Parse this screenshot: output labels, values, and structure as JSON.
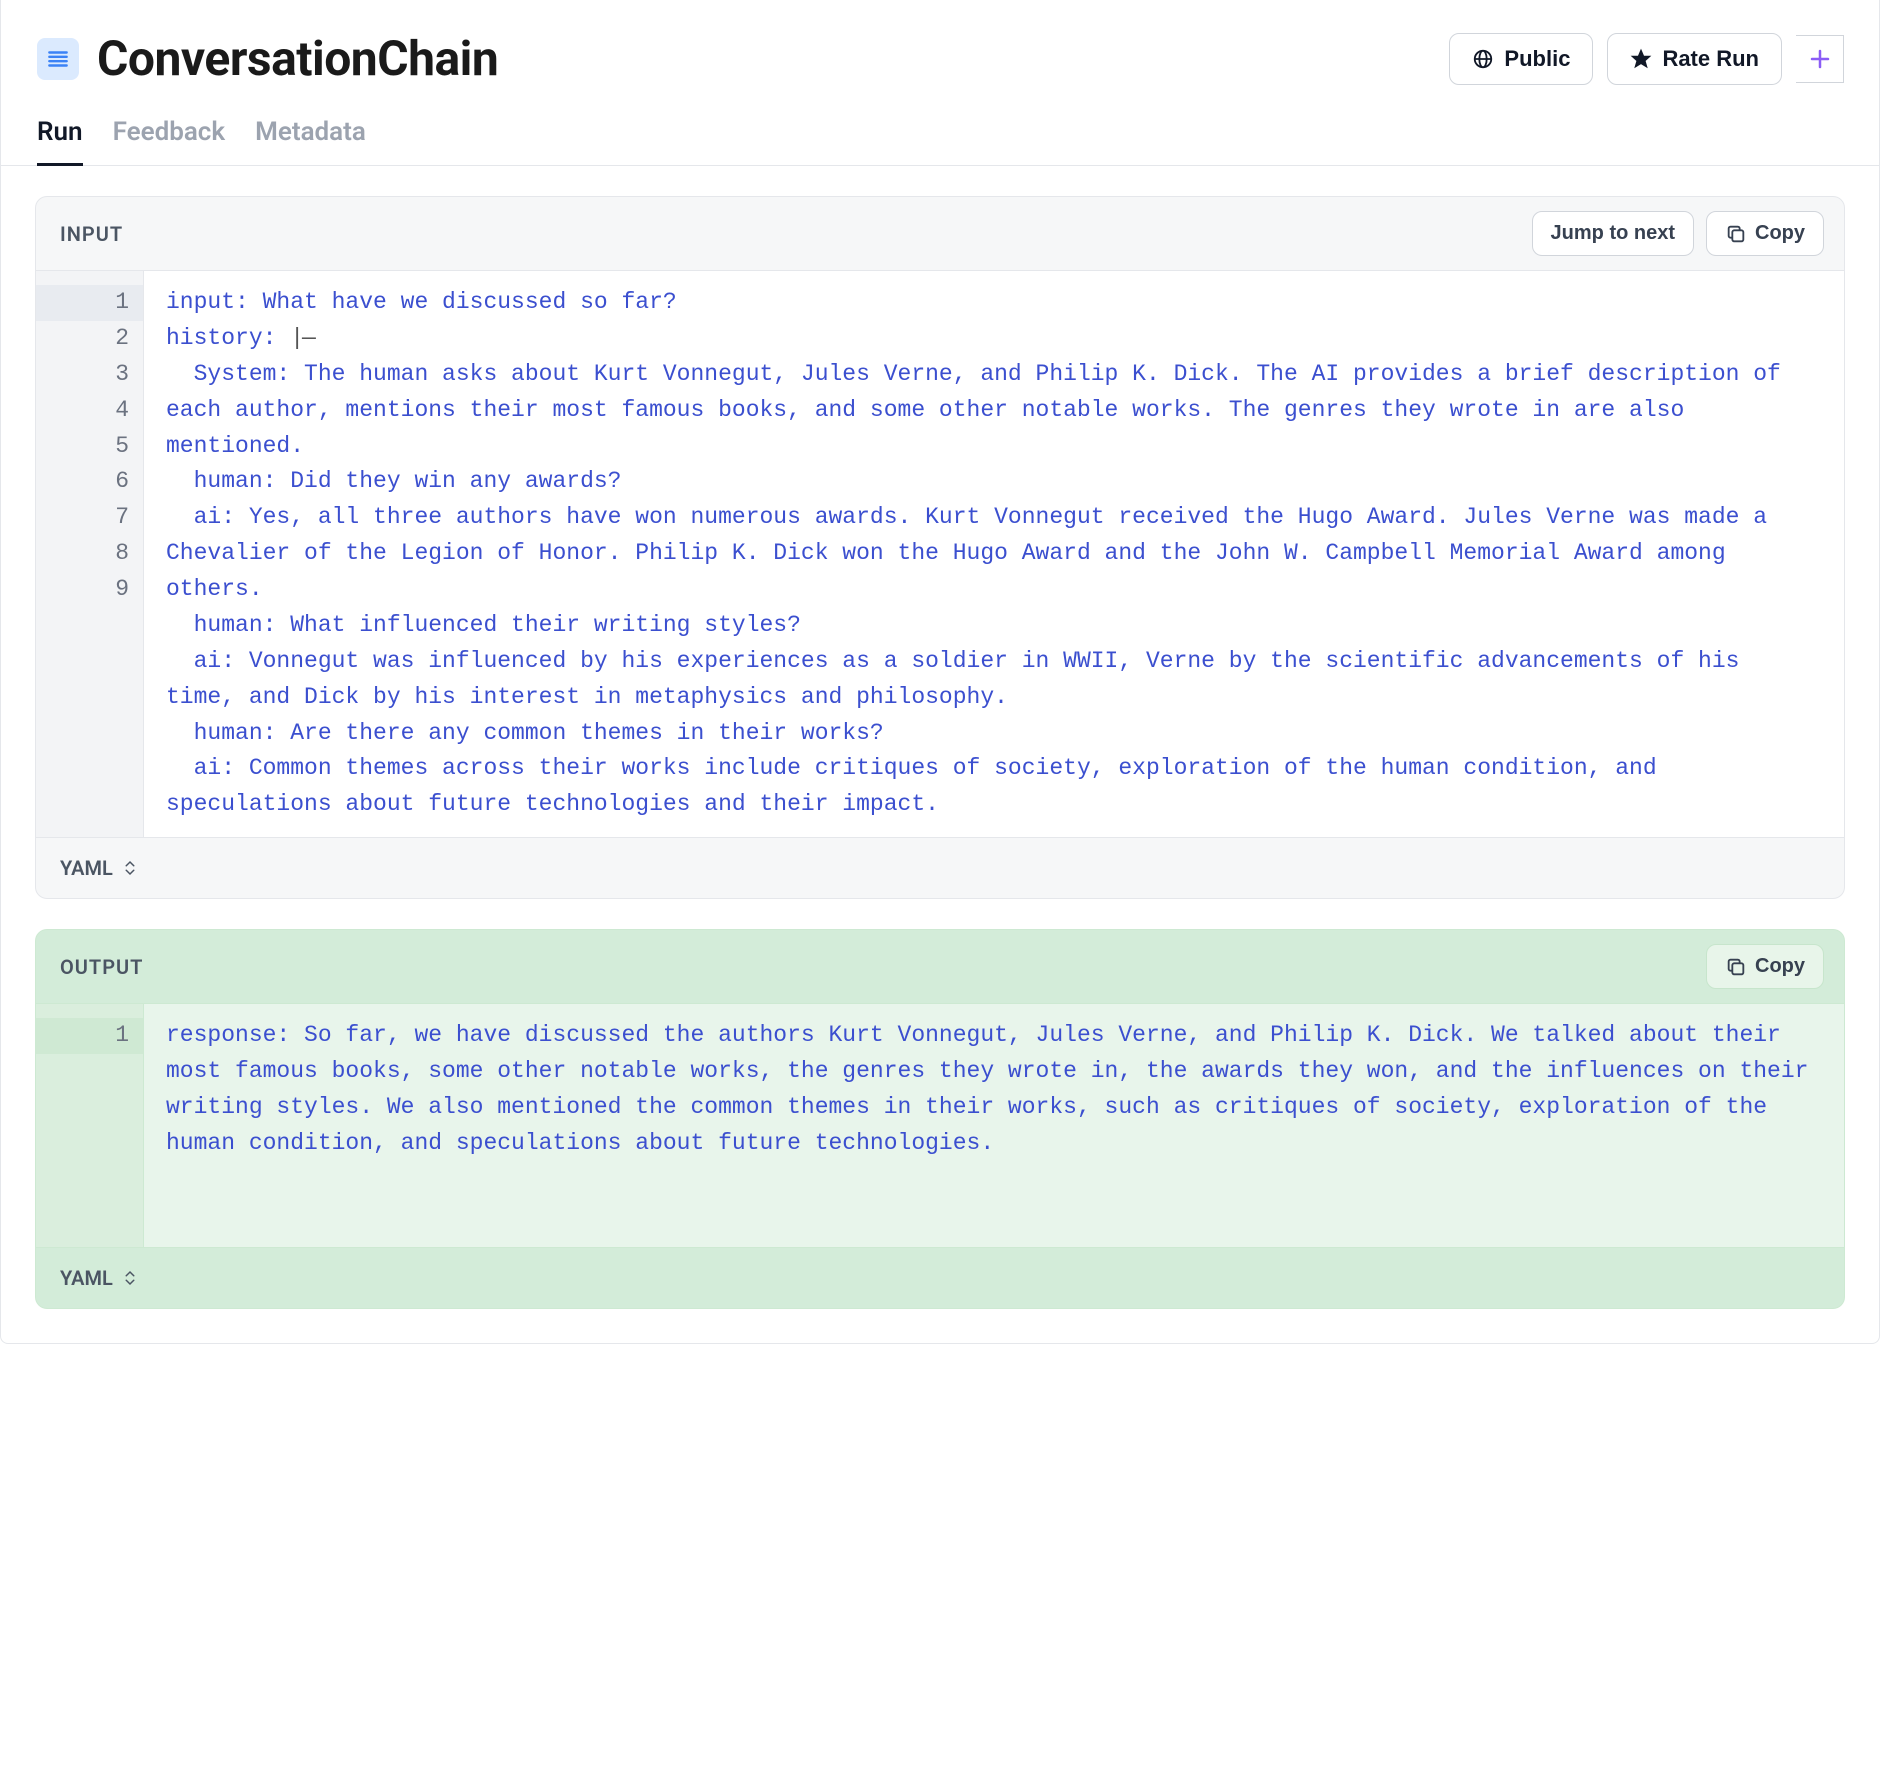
{
  "header": {
    "title": "ConversationChain",
    "public_label": "Public",
    "rate_label": "Rate Run"
  },
  "tabs": {
    "run": "Run",
    "feedback": "Feedback",
    "metadata": "Metadata"
  },
  "input_panel": {
    "title": "INPUT",
    "jump_label": "Jump to next",
    "copy_label": "Copy",
    "format_label": "YAML",
    "lines": {
      "l1": "input: What have we discussed so far?",
      "l2_key": "history",
      "l3": "  System: The human asks about Kurt Vonnegut, Jules Verne, and Philip K. Dick. The AI provides a brief description of each author, mentions their most famous books, and some other notable works. The genres they wrote in are also mentioned.",
      "l4": "  human: Did they win any awards?",
      "l5": "  ai: Yes, all three authors have won numerous awards. Kurt Vonnegut received the Hugo Award. Jules Verne was made a Chevalier of the Legion of Honor. Philip K. Dick won the Hugo Award and the John W. Campbell Memorial Award among others.",
      "l6": "  human: What influenced their writing styles?",
      "l7": "  ai: Vonnegut was influenced by his experiences as a soldier in WWII, Verne by the scientific advancements of his time, and Dick by his interest in metaphysics and philosophy.",
      "l8": "  human: Are there any common themes in their works?",
      "l9": "  ai: Common themes across their works include critiques of society, exploration of the human condition, and speculations about future technologies and their impact."
    },
    "line_numbers": [
      "1",
      "2",
      "3",
      "",
      "",
      "4",
      "5",
      "",
      "",
      "6",
      "7",
      "",
      "",
      "8",
      "9",
      ""
    ]
  },
  "output_panel": {
    "title": "OUTPUT",
    "copy_label": "Copy",
    "format_label": "YAML",
    "lines": {
      "l1": "response: So far, we have discussed the authors Kurt Vonnegut, Jules Verne, and Philip K. Dick. We talked about their most famous books, some other notable works, the genres they wrote in, the awards they won, and the influences on their writing styles. We also mentioned the common themes in their works, such as critiques of society, exploration of the human condition, and speculations about future technologies."
    },
    "line_numbers": [
      "1",
      "",
      "",
      "",
      "",
      ""
    ]
  }
}
